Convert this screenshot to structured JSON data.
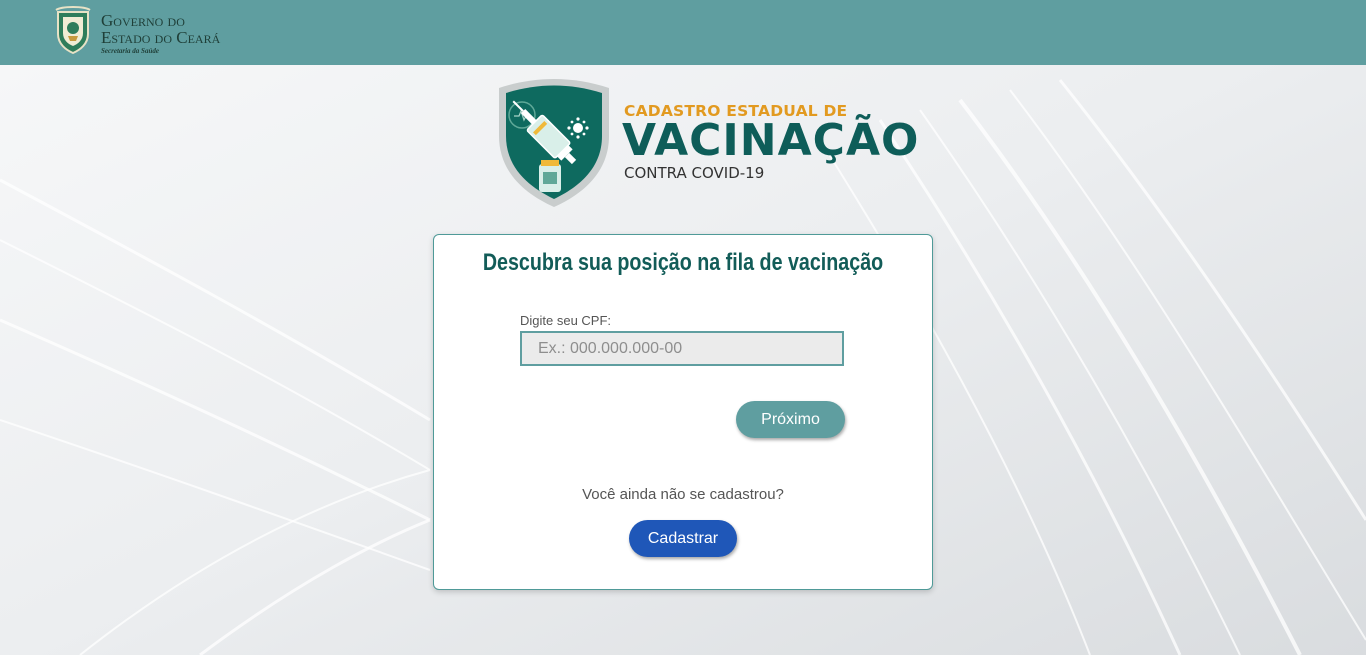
{
  "header": {
    "logo_line1": "Governo do",
    "logo_line2": "Estado do Ceará",
    "logo_line3": "Secretaria da Saúde",
    "background_color": "#5f9ea0"
  },
  "brand": {
    "top_line": "CADASTRO ESTADUAL DE",
    "main_line": "VACINAÇÃO",
    "sub_line": "CONTRA COVID-19",
    "colors": {
      "top": "#e29a20",
      "main": "#0e5d59"
    }
  },
  "form": {
    "title": "Descubra sua posição na fila de vacinação",
    "cpf_label": "Digite seu CPF:",
    "cpf_placeholder": "Ex.: 000.000.000-00",
    "cpf_value": "",
    "next_button": "Próximo",
    "not_registered_text": "Você ainda não se cadastrou?",
    "register_button": "Cadastrar",
    "colors": {
      "next_button": "#5f9ea0",
      "register_button": "#1f57b8",
      "title": "#125c58"
    }
  }
}
